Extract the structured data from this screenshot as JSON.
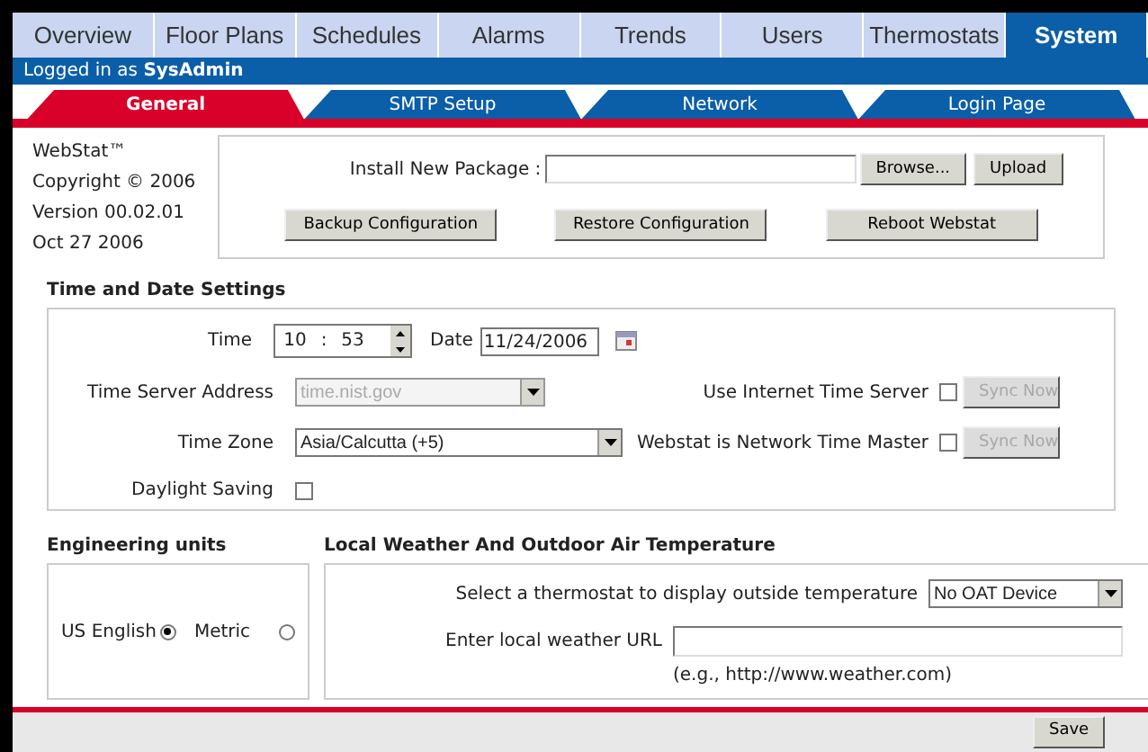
{
  "tabs": [
    {
      "label": "Overview",
      "selected": false
    },
    {
      "label": "Floor Plans",
      "selected": false
    },
    {
      "label": "Schedules",
      "selected": false
    },
    {
      "label": "Alarms",
      "selected": false
    },
    {
      "label": "Trends",
      "selected": false
    },
    {
      "label": "Users",
      "selected": false
    },
    {
      "label": "Thermostats",
      "selected": false
    },
    {
      "label": "System",
      "selected": true
    }
  ],
  "login": "Logged in as **SysAdmin**",
  "subtabs": [
    {
      "label": "General",
      "selected": true
    },
    {
      "label": "SMTP Setup",
      "selected": false
    },
    {
      "label": "Network",
      "selected": false
    },
    {
      "label": "Login Page",
      "selected": false
    }
  ],
  "about": [
    "WebStat™",
    "Copyright © 2006",
    "Version 00.02.01",
    "Oct 27 2006"
  ],
  "package": {
    "label": "Install New Package :",
    "browse": "Browse...",
    "upload": "Upload",
    "buttons": [
      "Backup Configuration",
      "Restore Configuration",
      "Reboot Webstat"
    ]
  },
  "time_date": {
    "title": "Time and Date Settings",
    "time_label": "Time",
    "hour": "10",
    "sep": ":",
    "minute": "53",
    "date_label": "Date",
    "date": "11/24/2006",
    "server_label": "Time Server Address",
    "server": "time.nist.gov",
    "server_disabled": true,
    "use_internet_label": "Use Internet Time Server",
    "use_internet_checked": false,
    "sync1": "Sync Now",
    "sync1_disabled": true,
    "zone_label": "Time Zone",
    "zone": "Asia/Calcutta (+5)",
    "master_label": "Webstat is Network Time Master",
    "master_checked": false,
    "sync2": "Sync Now",
    "sync2_disabled": true,
    "dst_label": "Daylight Saving",
    "dst_checked": false
  },
  "units": {
    "title": "Engineering units",
    "options": [
      {
        "label": "US English",
        "selected": true
      },
      {
        "label": "Metric",
        "selected": false
      }
    ]
  },
  "weather": {
    "title": "Local Weather And Outdoor Air Temperature",
    "select_label": "Select a thermostat to display outside temperature",
    "device": "No OAT Device",
    "url_label": "Enter local weather URL",
    "hint": "(e.g., http://www.weather.com)"
  },
  "save": "Save"
}
